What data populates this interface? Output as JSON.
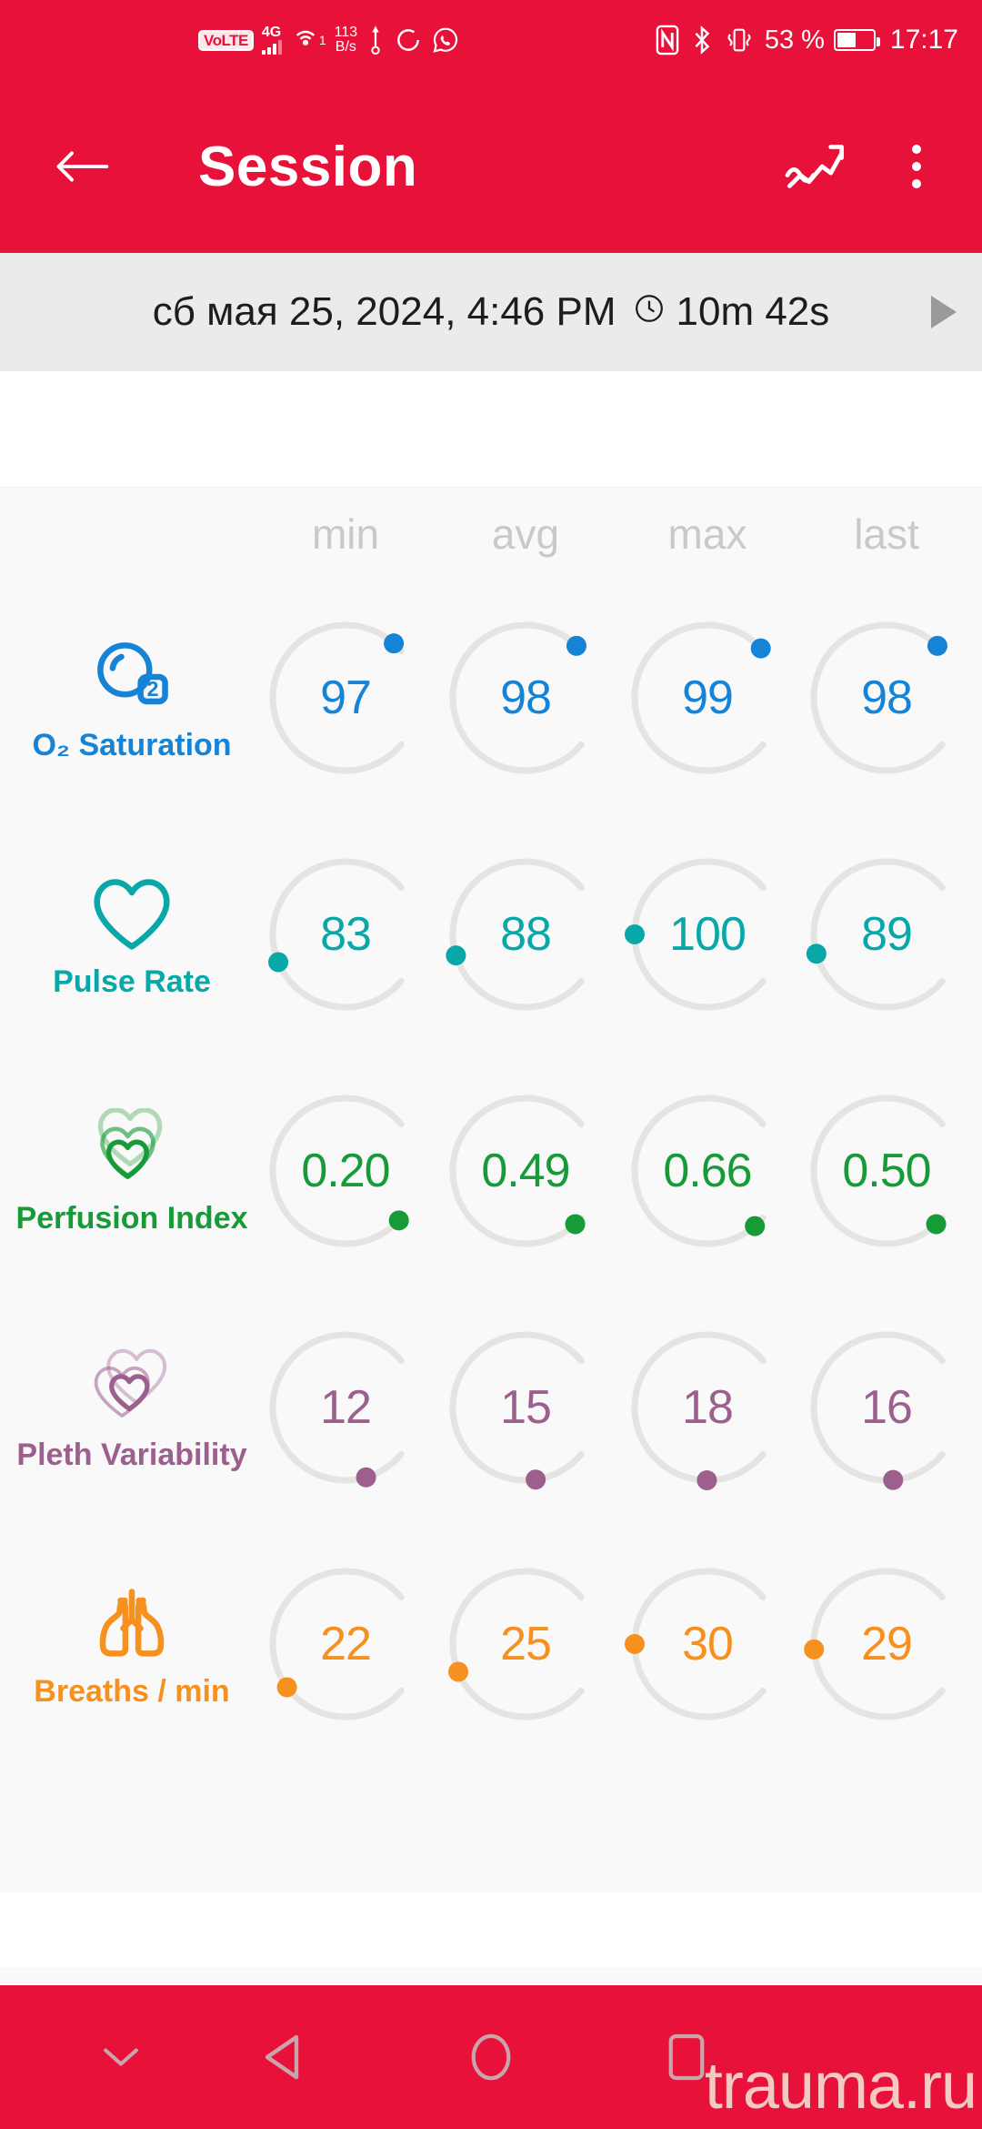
{
  "status_bar": {
    "volte": "VoLTE",
    "network_type": "4G",
    "hotspot_count": "1",
    "net_speed_value": "113",
    "net_speed_unit": "B/s",
    "icons": [
      "volte-icon",
      "signal-bars-icon",
      "hotspot-icon",
      "usb-icon",
      "sync-icon",
      "whatsapp-icon",
      "nfc-icon",
      "bluetooth-icon",
      "vibrate-icon",
      "battery-icon"
    ],
    "battery_percent": "53 %",
    "battery_level": 53,
    "time": "17:17"
  },
  "app_bar": {
    "title": "Session",
    "back_icon": "arrow-left-icon",
    "trend_icon": "trend-chart-icon",
    "overflow_icon": "more-vertical-icon"
  },
  "date_bar": {
    "date": "сб мая 25, 2024, 4:46 PM",
    "clock_icon": "clock-icon",
    "duration": "10m 42s",
    "play_icon": "play-triangle-icon"
  },
  "columns": [
    "min",
    "avg",
    "max",
    "last"
  ],
  "colors": {
    "brand_red": "#E8113A",
    "track": "#e6e4e0",
    "header_grey": "#c9c9c9",
    "o2": "#1583d6",
    "pulse": "#08a8a8",
    "perfusion": "#179b38",
    "pleth": "#9c5f8e",
    "breaths": "#f6901e"
  },
  "chart_data": {
    "type": "table",
    "title": "Session vitals summary",
    "columns": [
      "min",
      "avg",
      "max",
      "last"
    ],
    "rows": [
      {
        "label": "O₂ Saturation",
        "icon": "o2-bubble-icon",
        "color": "#1583d6",
        "values": [
          "97",
          "98",
          "99",
          "98"
        ],
        "numeric": [
          97,
          98,
          99,
          98
        ],
        "gauge_fraction": [
          0.97,
          0.98,
          0.99,
          0.98
        ],
        "range": [
          0,
          100
        ]
      },
      {
        "label": "Pulse Rate",
        "icon": "heart-outline-icon",
        "color": "#08a8a8",
        "values": [
          "83",
          "88",
          "100",
          "89"
        ],
        "numeric": [
          83,
          88,
          100,
          89
        ],
        "gauge_fraction": [
          0.42,
          0.44,
          0.5,
          0.445
        ],
        "range": [
          0,
          200
        ]
      },
      {
        "label": "Perfusion Index",
        "icon": "triple-heart-icon",
        "color": "#179b38",
        "values": [
          "0.20",
          "0.49",
          "0.66",
          "0.50"
        ],
        "numeric": [
          0.2,
          0.49,
          0.66,
          0.5
        ],
        "gauge_fraction": [
          0.01,
          0.025,
          0.033,
          0.025
        ],
        "range": [
          0,
          20
        ]
      },
      {
        "label": "Pleth Variability",
        "icon": "double-heart-icon",
        "color": "#9c5f8e",
        "values": [
          "12",
          "15",
          "18",
          "16"
        ],
        "numeric": [
          12,
          15,
          18,
          16
        ],
        "gauge_fraction": [
          0.12,
          0.15,
          0.18,
          0.16
        ],
        "range": [
          0,
          100
        ]
      },
      {
        "label": "Breaths / min",
        "icon": "lungs-icon",
        "color": "#f6901e",
        "values": [
          "22",
          "25",
          "30",
          "29"
        ],
        "numeric": [
          22,
          25,
          30,
          29
        ],
        "gauge_fraction": [
          0.37,
          0.42,
          0.5,
          0.485
        ],
        "range": [
          0,
          60
        ]
      }
    ]
  },
  "nav_bar": {
    "hide_icon": "chevron-down-icon",
    "back_icon": "back-triangle-icon",
    "home_icon": "home-circle-icon",
    "recents_icon": "recents-square-icon",
    "watermark": "trauma.ru"
  }
}
